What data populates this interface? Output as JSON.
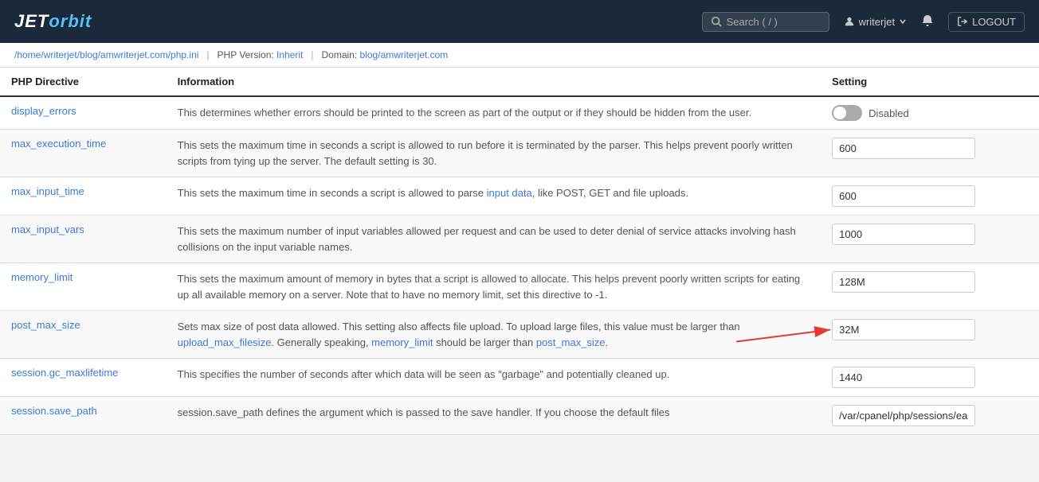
{
  "header": {
    "logo_je": "JET",
    "logo_orbit": "orbit",
    "logo_full": "JETorbit",
    "search_placeholder": "Search ( / )",
    "user_name": "writerjet",
    "logout_label": "LOGOUT"
  },
  "breadcrumb": {
    "path": "/home/writerjet/blog/amwriterjet.com/php.ini",
    "php_version": "PHP Version: Inherit",
    "domain": "Domain: blog/amwriterjet.com"
  },
  "table": {
    "col_directive": "PHP Directive",
    "col_info": "Information",
    "col_setting": "Setting",
    "rows": [
      {
        "directive": "display_errors",
        "info": "This determines whether errors should be printed to the screen as part of the output or if they should be hidden from the user.",
        "setting_type": "toggle",
        "toggle_state": "off",
        "toggle_label": "Disabled"
      },
      {
        "directive": "max_execution_time",
        "info": "This sets the maximum time in seconds a script is allowed to run before it is terminated by the parser. This helps prevent poorly written scripts from tying up the server. The default setting is 30.",
        "setting_type": "input",
        "setting_value": "600"
      },
      {
        "directive": "max_input_time",
        "info": "This sets the maximum time in seconds a script is allowed to parse input data, like POST, GET and file uploads.",
        "setting_type": "input",
        "setting_value": "600"
      },
      {
        "directive": "max_input_vars",
        "info": "This sets the maximum number of input variables allowed per request and can be used to deter denial of service attacks involving hash collisions on the input variable names.",
        "setting_type": "input",
        "setting_value": "1000"
      },
      {
        "directive": "memory_limit",
        "info": "This sets the maximum amount of memory in bytes that a script is allowed to allocate. This helps prevent poorly written scripts for eating up all available memory on a server. Note that to have no memory limit, set this directive to -1.",
        "setting_type": "input",
        "setting_value": "128M"
      },
      {
        "directive": "post_max_size",
        "info": "Sets max size of post data allowed. This setting also affects file upload. To upload large files, this value must be larger than upload_max_filesize. Generally speaking, memory_limit should be larger than post_max_size.",
        "setting_type": "input",
        "setting_value": "32M",
        "has_arrow": true
      },
      {
        "directive": "session.gc_maxlifetime",
        "info": "This specifies the number of seconds after which data will be seen as \"garbage\" and potentially cleaned up.",
        "setting_type": "input",
        "setting_value": "1440"
      },
      {
        "directive": "session.save_path",
        "info": "session.save_path defines the argument which is passed to the save handler. If you choose the default files",
        "setting_type": "input",
        "setting_value": "/var/cpanel/php/sessions/ea-php"
      }
    ]
  }
}
